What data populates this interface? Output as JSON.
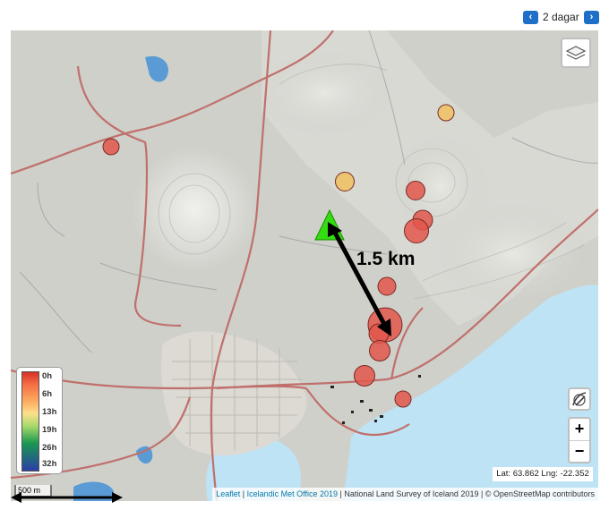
{
  "nav": {
    "prev_label": "‹",
    "period_label": "2 dagar",
    "next_label": "›"
  },
  "map": {
    "distance_label": "1.5 km",
    "eruption_marker": {
      "shape": "triangle",
      "color": "#33dd11"
    },
    "colors": {
      "land": "#cfd0ca",
      "water": "#bde3f5",
      "roads": "#c0706c",
      "town": "#ddd9d3"
    },
    "earthquakes": [
      {
        "age_hours": 13,
        "magnitude": 1.0
      },
      {
        "age_hours": 2,
        "magnitude": 1.0
      },
      {
        "age_hours": 12,
        "magnitude": 1.3
      },
      {
        "age_hours": 2,
        "magnitude": 1.3
      },
      {
        "age_hours": 2,
        "magnitude": 1.4
      },
      {
        "age_hours": 2,
        "magnitude": 1.9
      },
      {
        "age_hours": 2,
        "magnitude": 1.2
      },
      {
        "age_hours": 1,
        "magnitude": 3.0
      },
      {
        "age_hours": 2,
        "magnitude": 1.4
      },
      {
        "age_hours": 2,
        "magnitude": 1.5
      },
      {
        "age_hours": 2,
        "magnitude": 1.5
      },
      {
        "age_hours": 2,
        "magnitude": 1.0
      }
    ]
  },
  "controls": {
    "zoom_in": "+",
    "zoom_out": "−",
    "layers_icon": "layers-icon",
    "draw_icon": "draw-tool-icon"
  },
  "legend": {
    "labels": [
      "0h",
      "6h",
      "13h",
      "19h",
      "26h",
      "32h"
    ]
  },
  "coordinates": "Lat: 63.862 Lng: -22.352",
  "scale_label": "500 m",
  "attribution": {
    "leaflet": "Leaflet",
    "sep1": " | ",
    "imo": "Icelandic Met Office 2019",
    "rest": " | National Land Survey of Iceland 2019 | © OpenStreetMap contributors"
  }
}
